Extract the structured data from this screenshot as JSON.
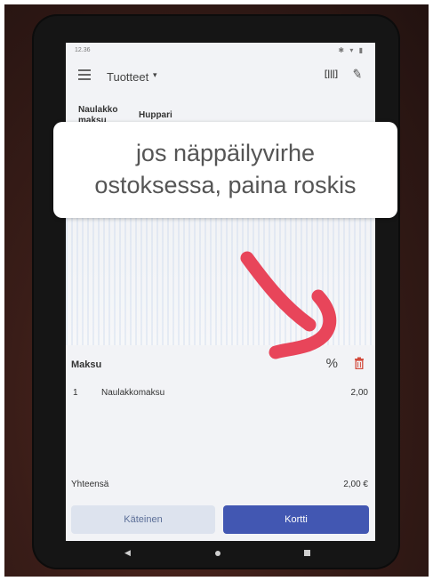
{
  "status_bar": {
    "time": "12.36",
    "icons": "✱ ▾ ▮"
  },
  "app_bar": {
    "title": "Tuotteet",
    "caret": "▾",
    "barcode_icon": "barcode-icon",
    "edit_icon": "pencil-icon"
  },
  "product_tabs": [
    {
      "label": "Naulakko maksu"
    },
    {
      "label": "Huppari"
    }
  ],
  "callout": {
    "line1": "jos näppäilyvirhe",
    "line2": "ostoksessa, paina roskis"
  },
  "payment": {
    "title": "Maksu",
    "discount_icon": "%",
    "trash_icon": "trash-icon",
    "items": [
      {
        "qty": "1",
        "name": "Naulakkomaksu",
        "price": "2,00"
      }
    ],
    "total_label": "Yhteensä",
    "total_value": "2,00 €"
  },
  "buttons": {
    "cash": "Käteinen",
    "card": "Kortti"
  },
  "colors": {
    "annotation_arrow": "#e8455a",
    "card_button": "#4257b2",
    "cash_button": "#dde3ee",
    "trash": "#d24b3c"
  },
  "nav": {
    "back": "◀"
  }
}
